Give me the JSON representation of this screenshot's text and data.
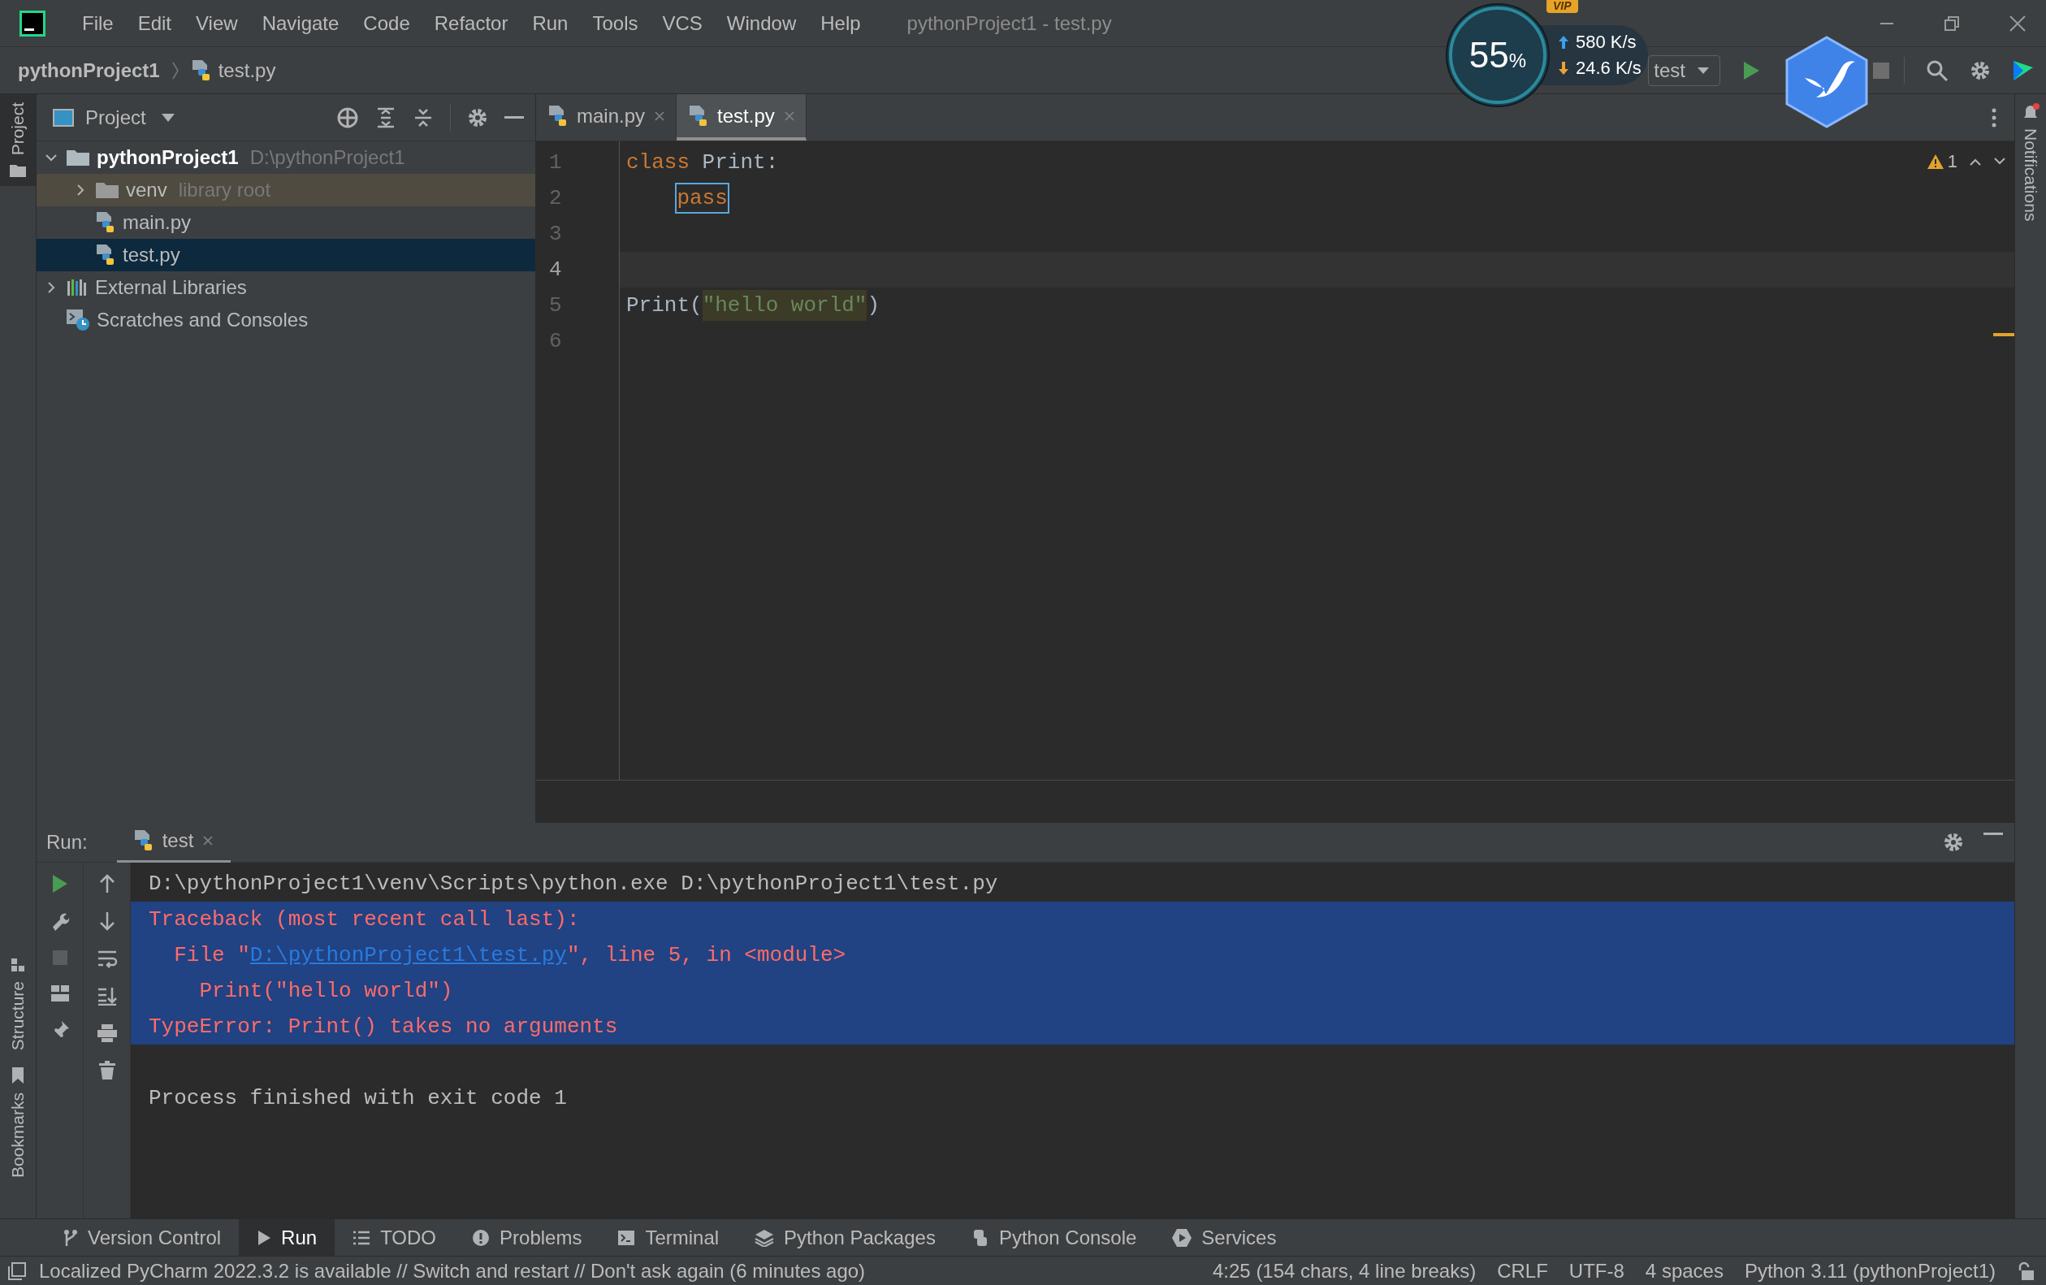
{
  "menu": [
    {
      "label": "File"
    },
    {
      "label": "Edit"
    },
    {
      "label": "View"
    },
    {
      "label": "Navigate"
    },
    {
      "label": "Code"
    },
    {
      "label": "Refactor"
    },
    {
      "label": "Run"
    },
    {
      "label": "Tools"
    },
    {
      "label": "VCS"
    },
    {
      "label": "Window"
    },
    {
      "label": "Help"
    }
  ],
  "window_title": "pythonProject1 - test.py",
  "breadcrumb": [
    "pythonProject1",
    "test.py"
  ],
  "run_config": {
    "label": "test"
  },
  "speed_meter": {
    "percent": "55",
    "percent_sign": "%",
    "upload": "580 K/s",
    "download": "24.6 K/s",
    "badge": "VIP"
  },
  "left_stripe": [
    {
      "label": "Project",
      "selected": true,
      "kind": "project"
    },
    {
      "label": "Structure",
      "selected": false,
      "kind": "structure"
    },
    {
      "label": "Bookmarks",
      "selected": false,
      "kind": "bookmarks"
    }
  ],
  "right_stripe": [
    {
      "label": "Notifications"
    }
  ],
  "project_panel": {
    "title": "Project",
    "tree": [
      {
        "name": "pythonProject1",
        "hint": "D:\\pythonProject1",
        "kind": "folder",
        "expanded": true,
        "selected": false,
        "children": [
          {
            "name": "venv",
            "hint": "library root",
            "kind": "library",
            "expanded": false,
            "selected": false
          },
          {
            "name": "main.py",
            "kind": "python",
            "selected": false
          },
          {
            "name": "test.py",
            "kind": "python",
            "selected": true
          }
        ]
      },
      {
        "name": "External Libraries",
        "kind": "libraries",
        "expanded": false,
        "selected": false
      },
      {
        "name": "Scratches and Consoles",
        "kind": "scratches",
        "selected": false
      }
    ]
  },
  "editor_tabs": [
    {
      "label": "main.py",
      "selected": false
    },
    {
      "label": "test.py",
      "selected": true
    }
  ],
  "editor": {
    "warnings": "1",
    "lines": [
      {
        "number": "1",
        "current": false,
        "tokens": [
          {
            "text": "class",
            "kind": "keyword"
          },
          {
            "text": " Print:",
            "kind": "plain"
          }
        ]
      },
      {
        "number": "2",
        "current": false,
        "tokens": [
          {
            "text": "pass",
            "kind": "boxed-keyword"
          }
        ]
      },
      {
        "number": "3",
        "current": false
      },
      {
        "number": "4",
        "current": true
      },
      {
        "number": "5",
        "current": false,
        "tokens": [
          {
            "text": "Print(",
            "kind": "plain"
          },
          {
            "text": "\"hello world\"",
            "kind": "marked-string"
          },
          {
            "text": ")",
            "kind": "plain"
          }
        ]
      },
      {
        "number": "6",
        "current": false
      }
    ]
  },
  "run_panel": {
    "label": "Run:",
    "tab": "test",
    "console": [
      {
        "kind": "command",
        "selected": false,
        "parts": [
          {
            "text": "D:\\pythonProject1\\venv\\Scripts\\python.exe D:\\pythonProject1\\test.py"
          }
        ]
      },
      {
        "kind": "error",
        "selected": true,
        "parts": [
          {
            "text": "Traceback (most recent call last):"
          }
        ]
      },
      {
        "kind": "error",
        "selected": true,
        "parts": [
          {
            "text": "  File \""
          },
          {
            "text": "D:\\pythonProject1\\test.py",
            "kind": "link"
          },
          {
            "text": "\", line 5, in <module>"
          }
        ]
      },
      {
        "kind": "error",
        "selected": true,
        "parts": [
          {
            "text": "    Print(\"hello world\")"
          }
        ]
      },
      {
        "kind": "error",
        "selected": true,
        "parts": [
          {
            "text": "TypeError: Print() takes no arguments"
          }
        ]
      },
      {
        "kind": "blank",
        "selected": false
      },
      {
        "kind": "command",
        "selected": false,
        "parts": [
          {
            "text": "Process finished with exit code 1"
          }
        ]
      }
    ]
  },
  "tool_tabs": [
    {
      "label": "Version Control",
      "kind": "branch",
      "selected": false
    },
    {
      "label": "Run",
      "kind": "run",
      "selected": true
    },
    {
      "label": "TODO",
      "kind": "list",
      "selected": false
    },
    {
      "label": "Problems",
      "kind": "problems",
      "selected": false
    },
    {
      "label": "Terminal",
      "kind": "terminal",
      "selected": false
    },
    {
      "label": "Python Packages",
      "kind": "layers",
      "selected": false
    },
    {
      "label": "Python Console",
      "kind": "python",
      "selected": false
    },
    {
      "label": "Services",
      "kind": "services",
      "selected": false
    }
  ],
  "status_bar": {
    "message": "Localized PyCharm 2022.3.2 is available // Switch and restart // Don't ask again (6 minutes ago)",
    "items": [
      "4:25 (154 chars, 4 line breaks)",
      "CRLF",
      "UTF-8",
      "4 spaces",
      "Python 3.11 (pythonProject1)"
    ]
  }
}
